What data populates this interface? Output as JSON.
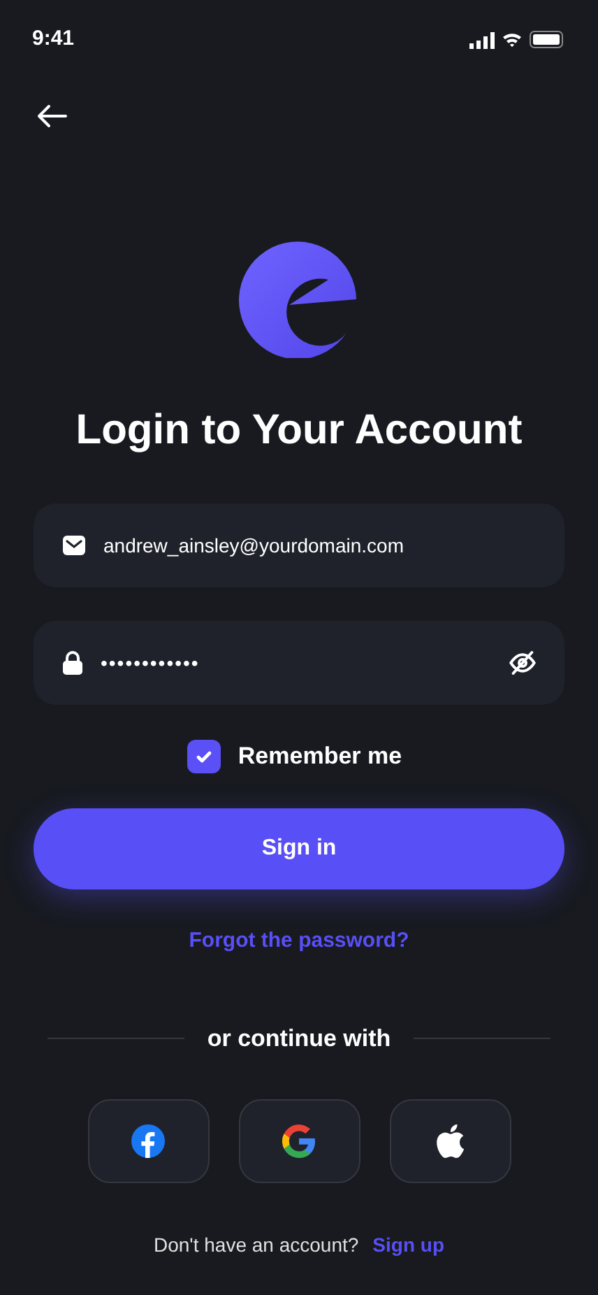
{
  "status_bar": {
    "time": "9:41"
  },
  "title": "Login to Your Account",
  "email_field": {
    "value": "andrew_ainsley@yourdomain.com"
  },
  "password_field": {
    "value": "••••••••••••",
    "hidden": true
  },
  "remember_me": {
    "label": "Remember me",
    "checked": true
  },
  "sign_in_button": "Sign in",
  "forgot_link": "Forgot the password?",
  "divider_text": "or continue with",
  "social_buttons": [
    {
      "kind": "facebook"
    },
    {
      "kind": "google"
    },
    {
      "kind": "apple"
    }
  ],
  "footer": {
    "prompt": "Don't have an account?",
    "link": "Sign up"
  }
}
